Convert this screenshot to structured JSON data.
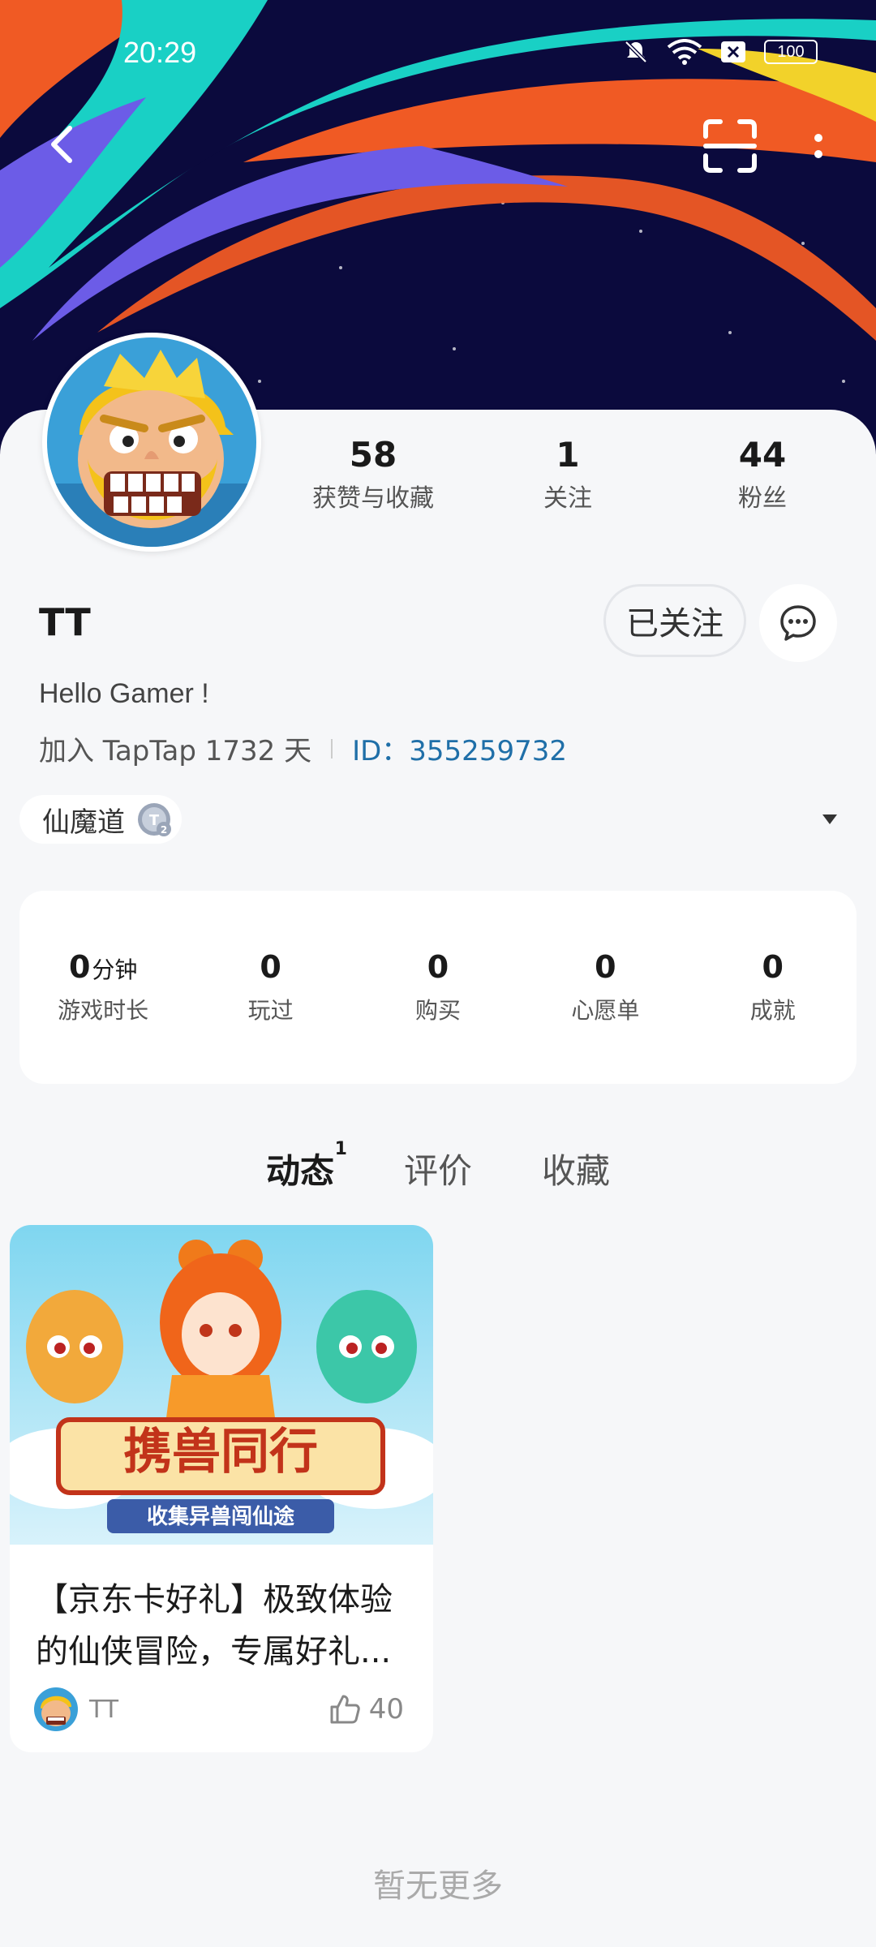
{
  "status_bar": {
    "time": "20:29",
    "battery": "100"
  },
  "icons": {
    "back": "back-arrow-icon",
    "scan": "scan-icon",
    "more": "more-vertical-icon",
    "message": "message-icon",
    "like": "thumbs-up-icon",
    "level": "level-badge-icon"
  },
  "profile": {
    "stats": [
      {
        "num": "58",
        "label": "获赞与收藏"
      },
      {
        "num": "1",
        "label": "关注"
      },
      {
        "num": "44",
        "label": "粉丝"
      }
    ],
    "name": "TT",
    "follow_label": "已关注",
    "bio": "Hello Gamer !",
    "join_text": "加入 TapTap 1732 天",
    "id_text": "ID：355259732",
    "tag": "仙魔道"
  },
  "game_stats": [
    {
      "num": "0",
      "unit": "分钟",
      "label": "游戏时长"
    },
    {
      "num": "0",
      "unit": "",
      "label": "玩过"
    },
    {
      "num": "0",
      "unit": "",
      "label": "购买"
    },
    {
      "num": "0",
      "unit": "",
      "label": "心愿单"
    },
    {
      "num": "0",
      "unit": "",
      "label": "成就"
    }
  ],
  "tabs": [
    {
      "label": "动态",
      "badge": "1"
    },
    {
      "label": "评价"
    },
    {
      "label": "收藏"
    }
  ],
  "post": {
    "image_title": "携兽同行",
    "image_subtitle": "收集异兽闯仙途",
    "title": "【京东卡好礼】极致体验的仙侠冒险，专属好礼...",
    "author": "TT",
    "likes": "40"
  },
  "footer": "暂无更多",
  "colors": {
    "accent": "#14cdc1",
    "id_link": "#1f6fa8",
    "banner_bg": "#0b0a3d"
  }
}
